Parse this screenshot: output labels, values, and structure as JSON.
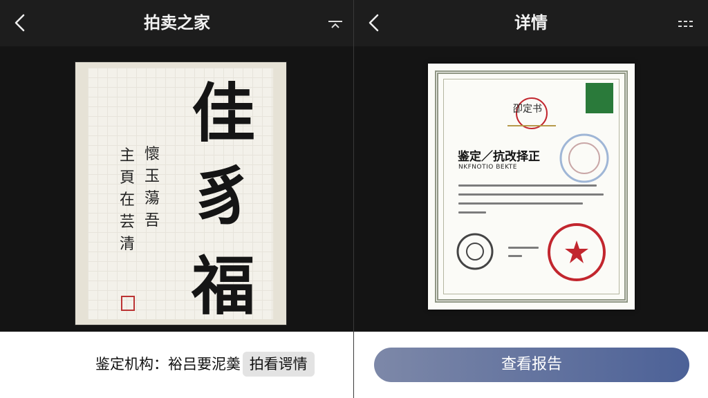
{
  "left": {
    "title": "拍卖之家",
    "artwork": {
      "big_chars": [
        "佳",
        "豸",
        "福"
      ],
      "side_cols": [
        "懷玉蕩吾",
        "主頁在芸清"
      ],
      "seal": "印章"
    },
    "appraisal": {
      "label": "鉴定机构：",
      "value": "裕吕要泥羮",
      "highlight": "拍看谔情"
    }
  },
  "right": {
    "title": "详情",
    "certificate": {
      "stamp_text": "卲定书",
      "title": "鉴定／抗改择正",
      "subtitle": "NKFNOTIO BEKTE"
    },
    "report_button": "查看报告"
  },
  "colors": {
    "navbar": "#1d1d1d",
    "button_start": "#7d88a8",
    "button_end": "#4c6197",
    "seal_red": "#c2262e"
  }
}
